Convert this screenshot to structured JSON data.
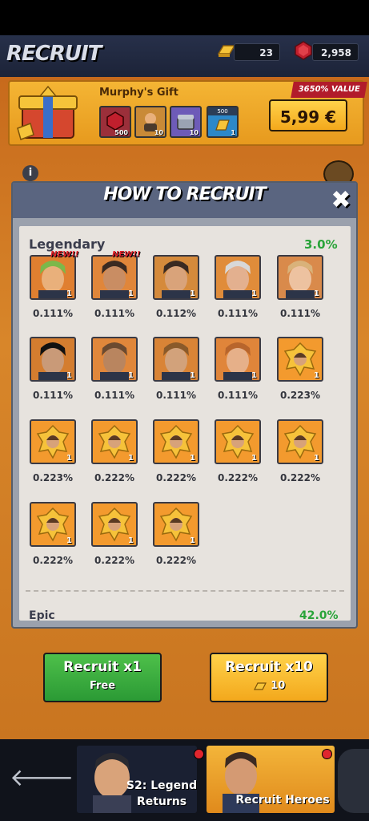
{
  "header": {
    "title": "RECRUIT",
    "gold_count": "23",
    "gems_count": "2,958"
  },
  "gift": {
    "title": "Murphy's Gift",
    "value_tag": "3650% VALUE",
    "price": "5,99 €",
    "items": [
      {
        "icon": "ruby-icon",
        "qty": "500",
        "color": "#9b2f3a"
      },
      {
        "icon": "hero-card-icon",
        "qty": "10",
        "color": "#c98a37"
      },
      {
        "icon": "chest-icon",
        "qty": "10",
        "color": "#6d5bb8"
      },
      {
        "icon": "gold-ticket-icon",
        "qty": "1",
        "top": "500",
        "color": "#2c88c9"
      }
    ]
  },
  "modal": {
    "title": "HOW TO RECRUIT",
    "close_label": "✖",
    "legendary": {
      "label": "Legendary",
      "rate": "3.0%",
      "new_label": "NEW!!",
      "cards": [
        {
          "pct": "0.111%",
          "qty": "1",
          "new": true,
          "style": "portrait",
          "bg": "#e07f30"
        },
        {
          "pct": "0.111%",
          "qty": "1",
          "new": true,
          "style": "portrait",
          "bg": "#e0863a"
        },
        {
          "pct": "0.112%",
          "qty": "1",
          "new": false,
          "style": "portrait",
          "bg": "#d58a3b"
        },
        {
          "pct": "0.111%",
          "qty": "1",
          "new": false,
          "style": "portrait",
          "bg": "#e08c3a"
        },
        {
          "pct": "0.111%",
          "qty": "1",
          "new": false,
          "style": "portrait",
          "bg": "#d98a4b"
        },
        {
          "pct": "0.111%",
          "qty": "1",
          "new": false,
          "style": "portrait",
          "bg": "#d47d2f"
        },
        {
          "pct": "0.111%",
          "qty": "1",
          "new": false,
          "style": "portrait",
          "bg": "#e0873b"
        },
        {
          "pct": "0.111%",
          "qty": "1",
          "new": false,
          "style": "portrait",
          "bg": "#d98436"
        },
        {
          "pct": "0.111%",
          "qty": "1",
          "new": false,
          "style": "portrait",
          "bg": "#e0853a"
        },
        {
          "pct": "0.223%",
          "qty": "1",
          "new": false,
          "style": "shard",
          "bg": "#f39a2e"
        },
        {
          "pct": "0.223%",
          "qty": "1",
          "new": false,
          "style": "shard",
          "bg": "#f39a2e"
        },
        {
          "pct": "0.222%",
          "qty": "1",
          "new": false,
          "style": "shard",
          "bg": "#f39a2e"
        },
        {
          "pct": "0.222%",
          "qty": "1",
          "new": false,
          "style": "shard",
          "bg": "#f39a2e"
        },
        {
          "pct": "0.222%",
          "qty": "1",
          "new": false,
          "style": "shard",
          "bg": "#f39a2e"
        },
        {
          "pct": "0.222%",
          "qty": "1",
          "new": false,
          "style": "shard",
          "bg": "#f39a2e"
        },
        {
          "pct": "0.222%",
          "qty": "1",
          "new": false,
          "style": "shard",
          "bg": "#f39a2e"
        },
        {
          "pct": "0.222%",
          "qty": "1",
          "new": false,
          "style": "shard",
          "bg": "#f39a2e"
        },
        {
          "pct": "0.222%",
          "qty": "1",
          "new": false,
          "style": "shard",
          "bg": "#f39a2e"
        }
      ]
    },
    "epic_partial": {
      "label": "Epic",
      "rate": "42.0%"
    }
  },
  "buttons": {
    "recruit_x1": {
      "label": "Recruit x1",
      "sub": "Free"
    },
    "recruit_x10": {
      "label": "Recruit x10",
      "cost": "10"
    }
  },
  "bottom_nav": {
    "tab1": "S2: Legend\nReturns",
    "tab2": "Recruit Heroes"
  },
  "colors": {
    "accent_green": "#2aa43a",
    "accent_red": "#e3242b",
    "accent_gold": "#f3a81c"
  }
}
